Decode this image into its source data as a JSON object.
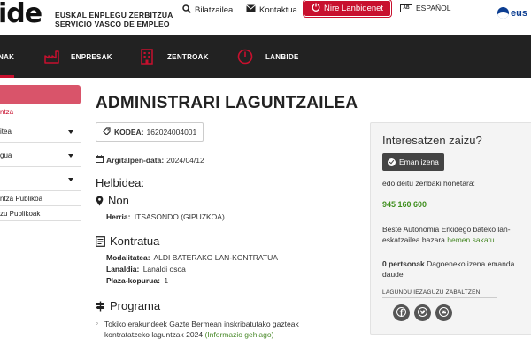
{
  "header": {
    "logo_text": "ide",
    "logo_sub_line1": "EUSKAL ENPLEGU ZERBITZUA",
    "logo_sub_line2": "SERVICIO VASCO DE EMPLEO",
    "search_label": "Bilatzailea",
    "contact_label": "Kontaktua",
    "nire_label": "Nire Lanbidenet",
    "lang_label": "ESPAÑOL",
    "lang_box": "AB",
    "right_logo": "eus"
  },
  "nav": {
    "items": [
      {
        "label": "NAK"
      },
      {
        "label": "ENPRESAK"
      },
      {
        "label": "ZENTROAK"
      },
      {
        "label": "LANBIDE"
      }
    ]
  },
  "sidebar": {
    "link": "ntza",
    "items": [
      {
        "label": "itea"
      },
      {
        "label": "gua"
      },
      {
        "label": ""
      }
    ],
    "subs": [
      {
        "label": "ntza Publikoa"
      },
      {
        "label": "zu Publikoak"
      }
    ]
  },
  "main": {
    "title": "ADMINISTRARI LAGUNTZAILEA",
    "code_label": "KODEA:",
    "code_value": "162024004001",
    "pub_label": "Argitalpen-data:",
    "pub_value": "2024/04/12",
    "helbidea": "Helbidea:",
    "non": "Non",
    "herria_label": "Herria:",
    "herria_value": "ITSASONDO (GIPUZKOA)",
    "kontratua": "Kontratua",
    "modalitatea_label": "Modalitatea:",
    "modalitatea_value": "ALDI BATERAKO LAN-KONTRATUA",
    "lanaldia_label": "Lanaldia:",
    "lanaldia_value": "Lanaldi osoa",
    "plaza_label": "Plaza-kopurua:",
    "plaza_value": "1",
    "programa": "Programa",
    "programa_text": "Tokiko erakundeek Gazte Bermean inskribatutako gazteak kontratatzeko laguntzak 2024",
    "programa_link": "(Informazio gehiago)"
  },
  "panel": {
    "title": "Interesatzen zaizu?",
    "button": "Eman izena",
    "call_text": "edo deitu zenbaki honetara:",
    "phone": "945 160 600",
    "other_text": "Beste Autonomia Erkidego bateko lan-eskatzailea bazara",
    "other_link": "hemen sakatu",
    "persons_bold": "0 pertsonak",
    "persons_text": "Dagoeneko izena emanda daude",
    "share_label": "LAGUNDU IEZAGUZU ZABALTZEN:"
  },
  "colors": {
    "brand_red": "#c8102e",
    "nav_bg": "#222222",
    "phone_green": "#3f8f1e"
  }
}
